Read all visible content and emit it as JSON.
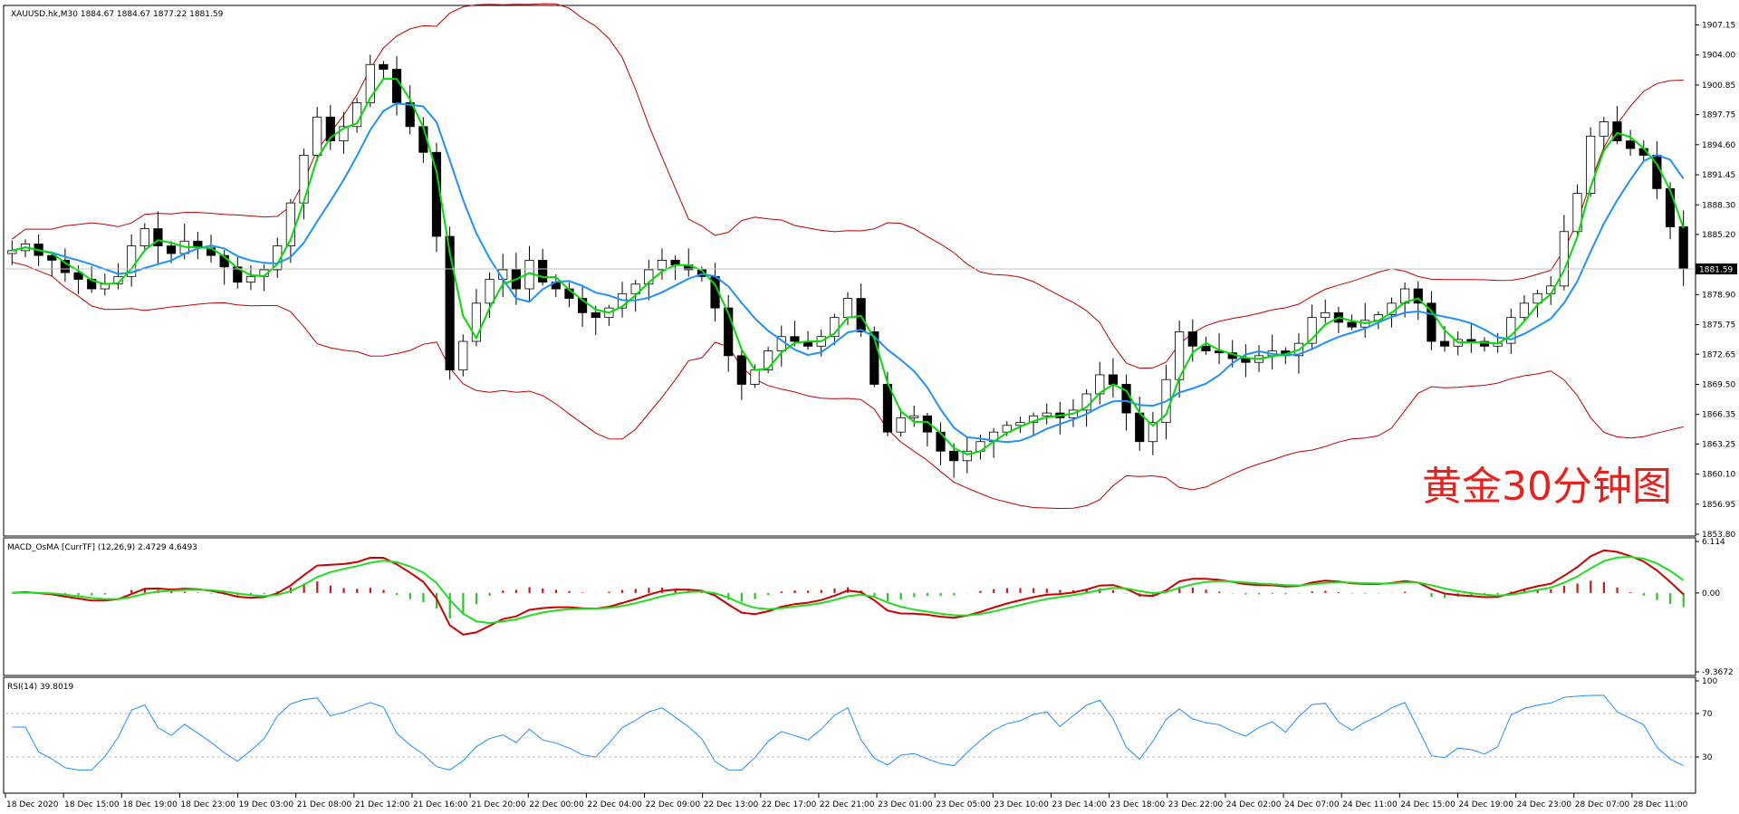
{
  "chart_data": {
    "type": "candlestick",
    "symbol_header": "XAUUSD.hk,M30  1884.67 1884.67 1877.22 1881.59",
    "annotation": "黄金30分钟图",
    "current_price_label": "1881.59",
    "current_price": 1881.59,
    "price_axis": {
      "range": [
        1853.8,
        1909.0
      ],
      "ticks": [
        "1907.15",
        "1904.00",
        "1900.85",
        "1897.75",
        "1894.60",
        "1891.45",
        "1888.30",
        "1885.20",
        "1878.90",
        "1875.75",
        "1872.65",
        "1869.50",
        "1866.35",
        "1863.25",
        "1860.10",
        "1856.95",
        "1853.80"
      ]
    },
    "time_axis": {
      "labels": [
        "18 Dec 2020",
        "18 Dec 15:00",
        "18 Dec 19:00",
        "18 Dec 23:00",
        "19 Dec 03:00",
        "21 Dec 08:00",
        "21 Dec 12:00",
        "21 Dec 16:00",
        "21 Dec 20:00",
        "22 Dec 00:00",
        "22 Dec 04:00",
        "22 Dec 09:00",
        "22 Dec 13:00",
        "22 Dec 17:00",
        "22 Dec 21:00",
        "23 Dec 01:00",
        "23 Dec 05:00",
        "23 Dec 10:00",
        "23 Dec 14:00",
        "23 Dec 18:00",
        "23 Dec 22:00",
        "24 Dec 02:00",
        "24 Dec 07:00",
        "24 Dec 11:00",
        "24 Dec 15:00",
        "24 Dec 19:00",
        "24 Dec 23:00",
        "28 Dec 07:00",
        "28 Dec 11:00"
      ]
    },
    "close_path": [
      1883.5,
      1884.2,
      1883.0,
      1882.5,
      1881.2,
      1880.5,
      1879.5,
      1880.0,
      1880.8,
      1884.0,
      1885.8,
      1884.0,
      1883.2,
      1884.5,
      1883.8,
      1883.0,
      1881.8,
      1880.2,
      1880.8,
      1881.5,
      1884.0,
      1888.5,
      1893.5,
      1897.5,
      1895.0,
      1896.5,
      1899.0,
      1903.0,
      1902.5,
      1899.0,
      1896.5,
      1893.8,
      1885.0,
      1871.0,
      1874.0,
      1878.0,
      1880.5,
      1881.5,
      1879.5,
      1882.5,
      1880.2,
      1879.5,
      1878.5,
      1877.0,
      1876.5,
      1877.5,
      1879.0,
      1880.0,
      1881.5,
      1882.5,
      1882.0,
      1881.5,
      1880.8,
      1877.5,
      1872.5,
      1869.5,
      1871.0,
      1873.0,
      1874.5,
      1874.0,
      1873.5,
      1874.5,
      1876.5,
      1878.5,
      1875.0,
      1869.5,
      1864.5,
      1866.0,
      1866.2,
      1864.5,
      1862.5,
      1861.5,
      1862.5,
      1863.5,
      1864.5,
      1865.2,
      1865.5,
      1866.2,
      1866.5,
      1866.0,
      1866.8,
      1868.5,
      1870.5,
      1869.5,
      1866.5,
      1863.5,
      1865.5,
      1870.0,
      1875.0,
      1873.5,
      1873.0,
      1872.8,
      1872.2,
      1871.8,
      1872.5,
      1873.0,
      1872.5,
      1873.8,
      1876.5,
      1877.0,
      1876.0,
      1875.5,
      1876.2,
      1876.8,
      1878.0,
      1879.5,
      1878.0,
      1874.0,
      1873.5,
      1874.2,
      1874.0,
      1873.5,
      1873.8,
      1876.5,
      1878.0,
      1879.0,
      1879.8,
      1885.5,
      1889.5,
      1895.5,
      1897.0,
      1895.0,
      1894.2,
      1893.5,
      1890.0,
      1886.0,
      1881.59
    ],
    "ma_fast_color": "#00dd00",
    "ma_slow_color": "#1e90ff",
    "bands_color": "#c00000",
    "macd": {
      "label": "MACD_OsMA [CurrTF] (12,26,9) 2.4729 4.6493",
      "range": [
        -9.3672,
        6.114
      ],
      "ticks": [
        "6.114",
        "0.00",
        "-9.3672"
      ]
    },
    "rsi": {
      "label": "RSI(14) 39.8019",
      "range": [
        0,
        100
      ],
      "levels": [
        70,
        30
      ],
      "ticks": [
        "100",
        "70",
        "30",
        "0"
      ]
    }
  }
}
